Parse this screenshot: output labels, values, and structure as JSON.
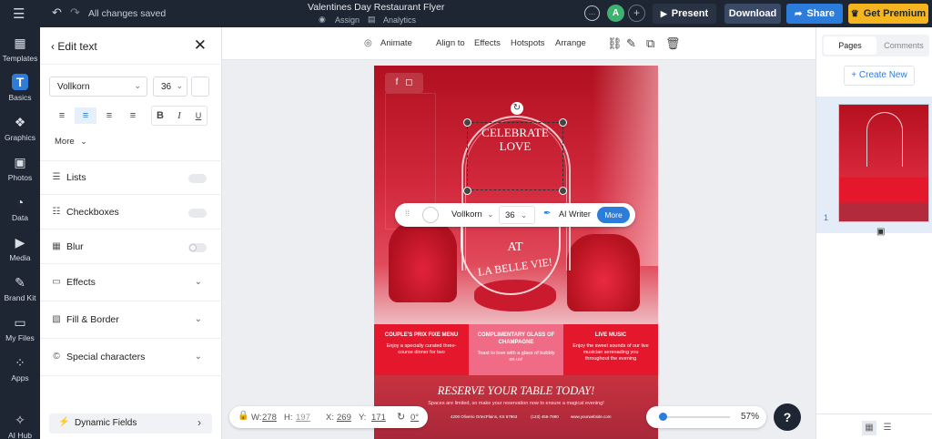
{
  "topbar": {
    "doc_title": "Valentines Day Restaurant Flyer",
    "save_status": "All changes saved",
    "assign_label": "Assign",
    "analytics_label": "Analytics",
    "avatar_initial": "A",
    "present_label": "Present",
    "download_label": "Download",
    "share_label": "Share",
    "premium_label": "Get Premium"
  },
  "rail": {
    "items": [
      {
        "label": "Templates",
        "icon": "grid-icon"
      },
      {
        "label": "Basics",
        "icon": "text-t-icon"
      },
      {
        "label": "Graphics",
        "icon": "shapes-icon"
      },
      {
        "label": "Photos",
        "icon": "image-icon"
      },
      {
        "label": "Data",
        "icon": "pie-chart-icon"
      },
      {
        "label": "Media",
        "icon": "video-icon"
      },
      {
        "label": "Brand Kit",
        "icon": "brand-kit-icon"
      },
      {
        "label": "My Files",
        "icon": "folder-icon"
      },
      {
        "label": "Apps",
        "icon": "apps-icon"
      },
      {
        "label": "AI Hub",
        "icon": "sparkle-icon"
      }
    ]
  },
  "panel": {
    "title": "Edit text",
    "font_family": "Vollkorn",
    "font_size": "36",
    "more_label": "More",
    "options": [
      {
        "label": "Lists",
        "control": "toggle"
      },
      {
        "label": "Checkboxes",
        "control": "toggle"
      },
      {
        "label": "Blur",
        "control": "toggle"
      },
      {
        "label": "Effects",
        "control": "expand"
      },
      {
        "label": "Fill & Border",
        "control": "expand"
      },
      {
        "label": "Special characters",
        "control": "expand"
      }
    ],
    "dynamic_fields_label": "Dynamic Fields"
  },
  "canvas_toolbar": {
    "animate": "Animate",
    "align_to": "Align to",
    "effects": "Effects",
    "hotspots": "Hotspots",
    "arrange": "Arrange"
  },
  "flyer": {
    "headline_1": "CELEBRATE",
    "headline_2": "LOVE",
    "at": "AT",
    "venue": "LA BELLE VIE!",
    "panels": [
      {
        "title": "COUPLE'S PRIX FIXE MENU",
        "body": "Enjoy a specially curated three-course dinner for two"
      },
      {
        "title": "COMPLIMENTARY GLASS OF CHAMPAGNE",
        "body": "Toast to love with a glass of bubbly on us!"
      },
      {
        "title": "LIVE MUSIC",
        "body": "Enjoy the sweet sounds of our live musician serenading you throughout the evening"
      }
    ],
    "cta": "RESERVE YOUR TABLE TODAY!",
    "cta_sub": "Spaces are limited, so make your reservation now to ensure a magical evening!",
    "footer": {
      "address": "4200 Oliverio OrtezPlains, KS 67863",
      "phone": "(123) 456-7890",
      "website": "www.yourwebsite.com"
    }
  },
  "float_toolbar": {
    "font": "Vollkorn",
    "size": "36",
    "ai_writer": "AI Writer",
    "more": "More"
  },
  "status_bar": {
    "w_label": "W:",
    "w_value": "278",
    "h_label": "H:",
    "h_value": "197",
    "x_label": "X:",
    "x_value": "269",
    "y_label": "Y:",
    "y_value": "171",
    "rotation": "0°",
    "zoom": "57%",
    "zoom_level": 0.05
  },
  "help_label": "?",
  "right_panel": {
    "tab_pages": "Pages",
    "tab_comments": "Comments",
    "create_new": "+ Create New",
    "page_number": "1"
  }
}
